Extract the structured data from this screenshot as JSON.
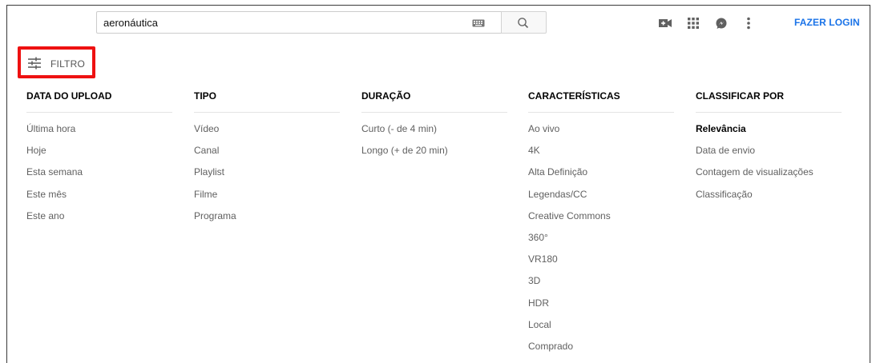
{
  "search": {
    "query": "aeronáutica"
  },
  "header": {
    "login_label": "FAZER LOGIN"
  },
  "filter": {
    "label": "FILTRO"
  },
  "columns": [
    {
      "title": "DATA DO UPLOAD",
      "items": [
        "Última hora",
        "Hoje",
        "Esta semana",
        "Este mês",
        "Este ano"
      ]
    },
    {
      "title": "TIPO",
      "items": [
        "Vídeo",
        "Canal",
        "Playlist",
        "Filme",
        "Programa"
      ]
    },
    {
      "title": "DURAÇÃO",
      "items": [
        "Curto (- de 4 min)",
        "Longo (+ de 20 min)"
      ]
    },
    {
      "title": "CARACTERÍSTICAS",
      "items": [
        "Ao vivo",
        "4K",
        "Alta Definição",
        "Legendas/CC",
        "Creative Commons",
        "360°",
        "VR180",
        "3D",
        "HDR",
        "Local",
        "Comprado"
      ]
    },
    {
      "title": "CLASSIFICAR POR",
      "items": [
        "Relevância",
        "Data de envio",
        "Contagem de visualizações",
        "Classificação"
      ],
      "selected_index": 0
    }
  ],
  "colors": {
    "accent": "#1a73e8",
    "highlight_border": "#ee1111",
    "muted_text": "#606060"
  },
  "icons": {
    "keyboard": "keyboard-icon",
    "search": "search-icon",
    "create": "video-camera-plus-icon",
    "apps": "apps-grid-icon",
    "messages": "messages-icon",
    "more": "more-vert-icon",
    "filter": "tune-icon"
  }
}
